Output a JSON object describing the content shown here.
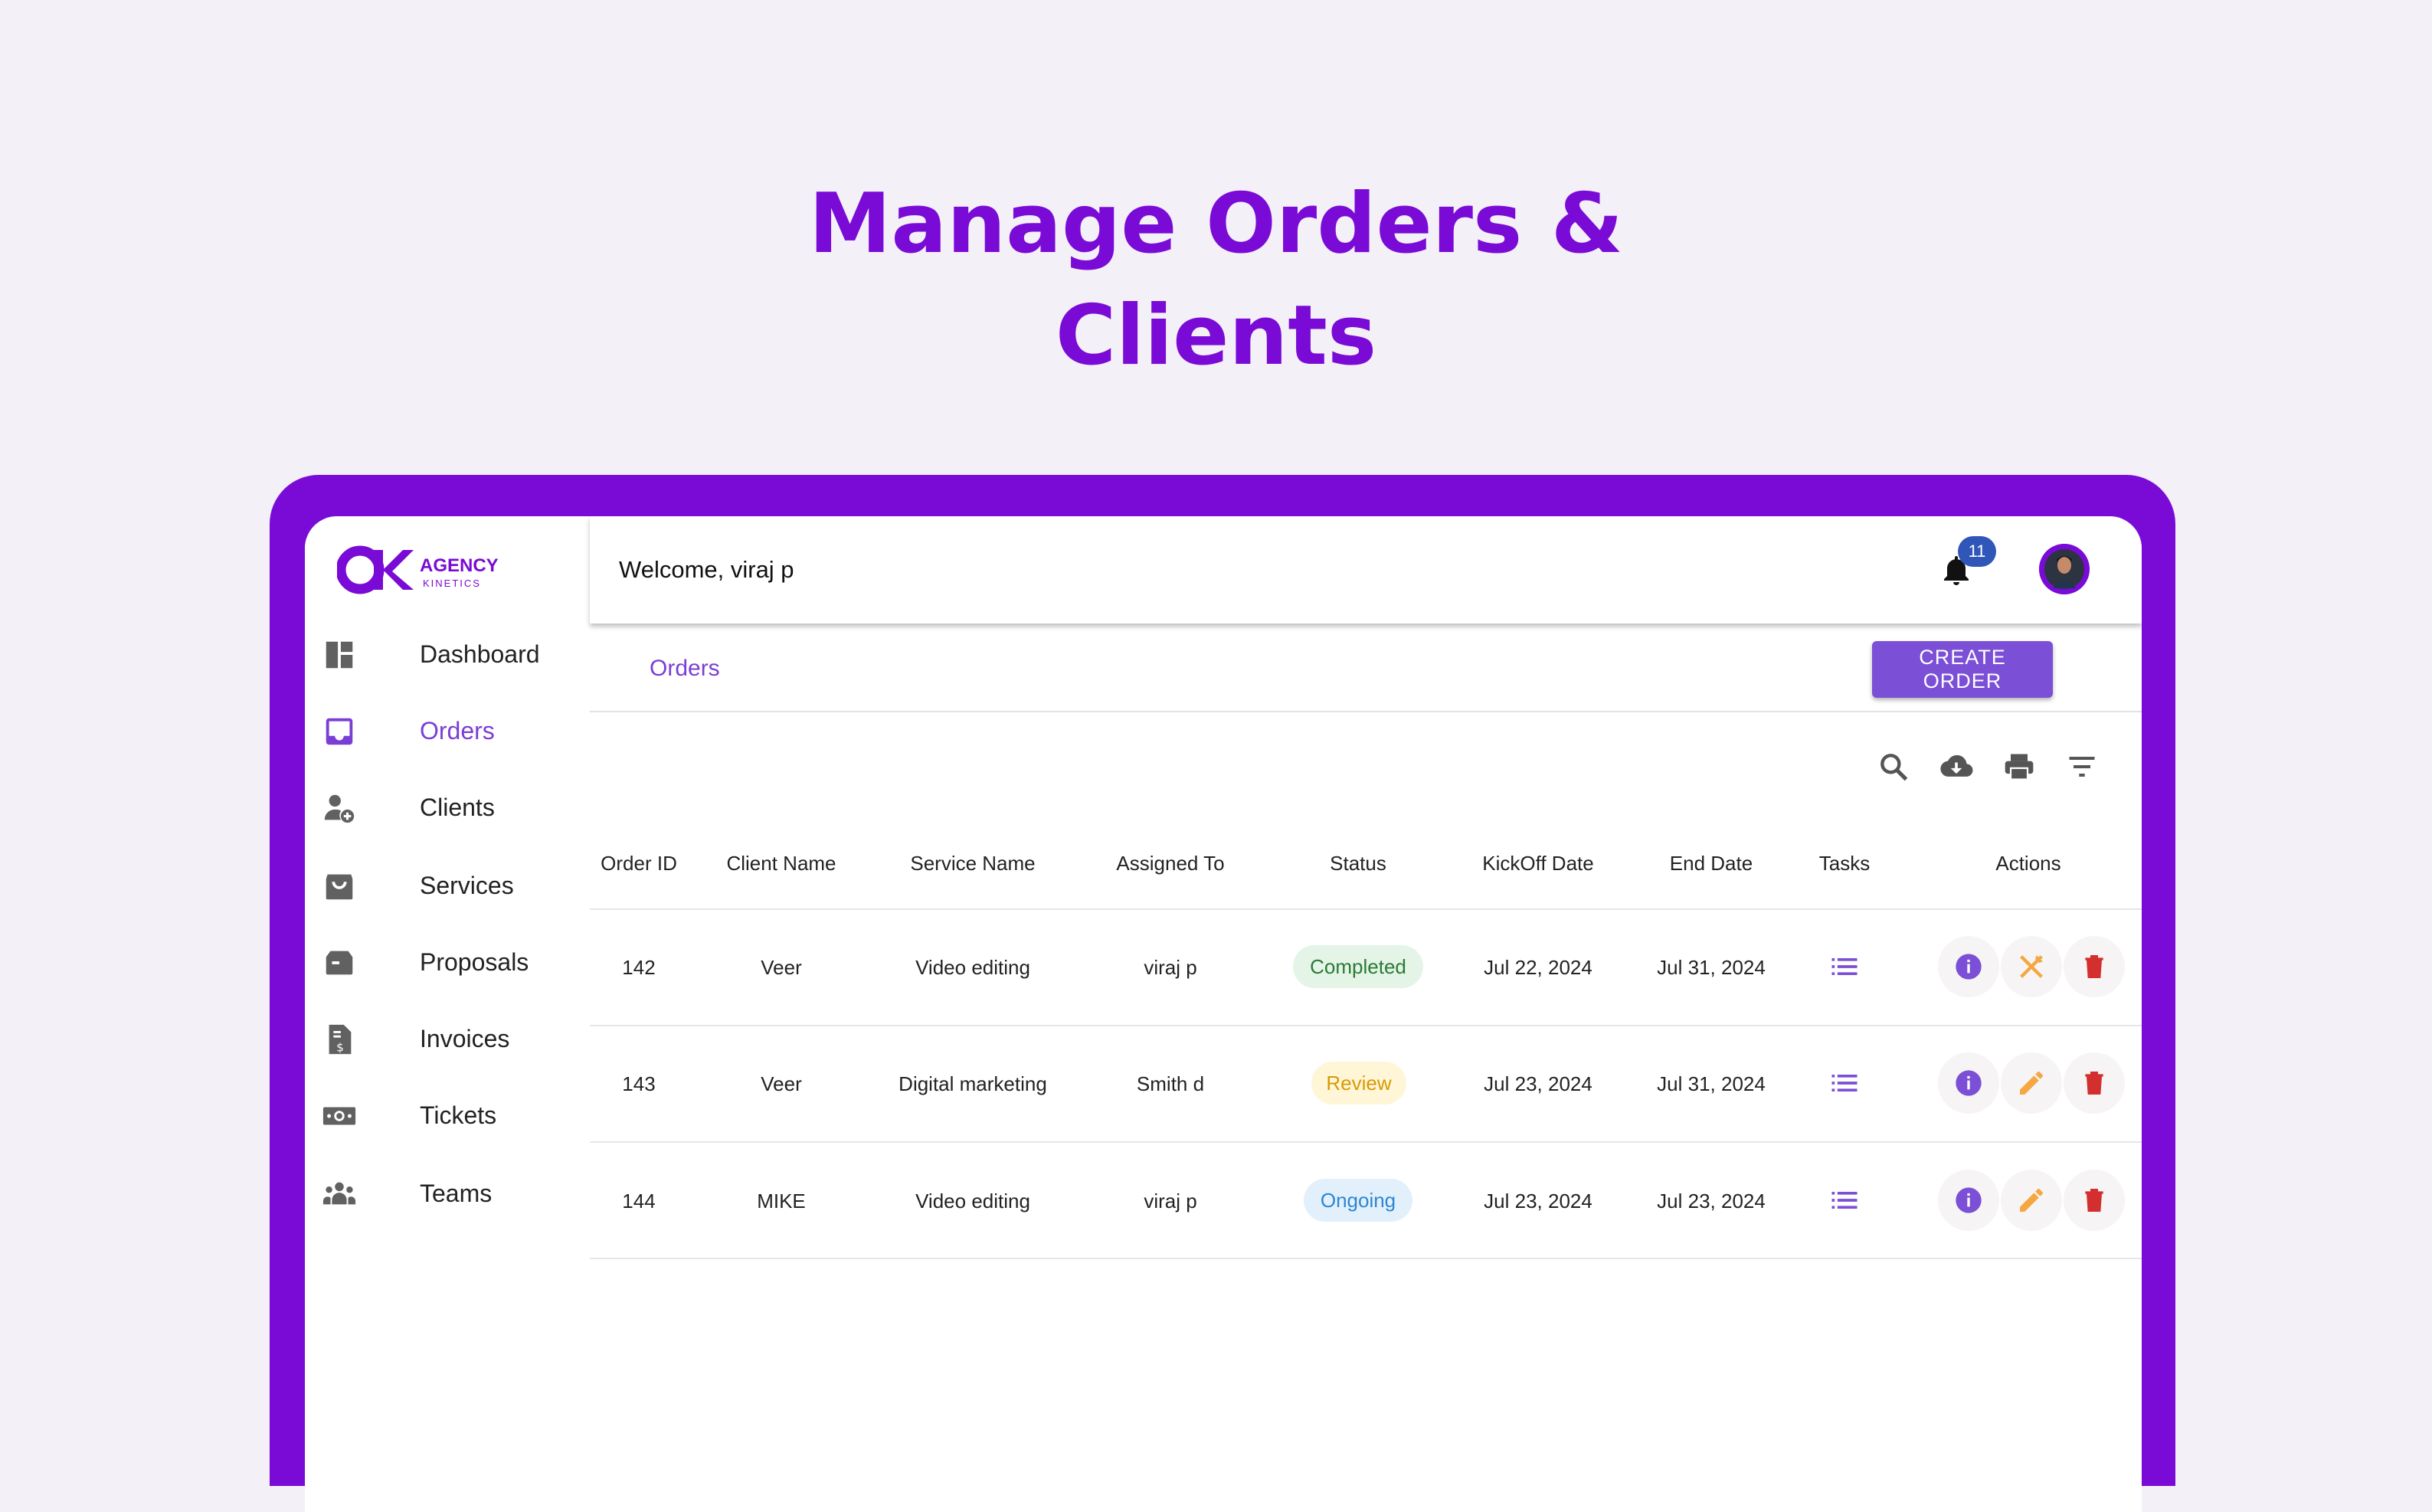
{
  "hero": {
    "line1": "Manage Orders &",
    "line2": "Clients"
  },
  "brand": {
    "mark": "AK",
    "name": "AGENCY",
    "tagline": "KINETICS",
    "color": "#7a0bd6"
  },
  "header": {
    "welcome": "Welcome, viraj p",
    "notification_count": "11"
  },
  "sidebar": {
    "items": [
      {
        "label": "Dashboard",
        "icon": "dashboard-icon"
      },
      {
        "label": "Orders",
        "icon": "inbox-icon",
        "active": true
      },
      {
        "label": "Clients",
        "icon": "add-person-icon"
      },
      {
        "label": "Services",
        "icon": "shopping-bag-icon"
      },
      {
        "label": "Proposals",
        "icon": "mailbox-icon"
      },
      {
        "label": "Invoices",
        "icon": "invoice-icon"
      },
      {
        "label": "Tickets",
        "icon": "money-icon"
      },
      {
        "label": "Teams",
        "icon": "groups-icon"
      }
    ]
  },
  "page": {
    "breadcrumb": "Orders",
    "create_label": "CREATE ORDER"
  },
  "table": {
    "columns": [
      "Order ID",
      "Client Name",
      "Service Name",
      "Assigned To",
      "Status",
      "KickOff Date",
      "End Date",
      "Tasks",
      "Actions"
    ],
    "rows": [
      {
        "id": "142",
        "client": "Veer",
        "service": "Video editing",
        "assigned": "viraj p",
        "status": "Completed",
        "kickoff": "Jul 22, 2024",
        "end": "Jul 31, 2024"
      },
      {
        "id": "143",
        "client": "Veer",
        "service": "Digital marketing",
        "assigned": "Smith d",
        "status": "Review",
        "kickoff": "Jul 23, 2024",
        "end": "Jul 31, 2024"
      },
      {
        "id": "144",
        "client": "MIKE",
        "service": "Video editing",
        "assigned": "viraj p",
        "status": "Ongoing",
        "kickoff": "Jul 23, 2024",
        "end": "Jul 23, 2024"
      }
    ]
  },
  "colors": {
    "accent": "#7a0bd6",
    "button": "#7b4fd6",
    "delete": "#d32f2f",
    "edit": "#f5a742",
    "info": "#7b4fd6"
  }
}
